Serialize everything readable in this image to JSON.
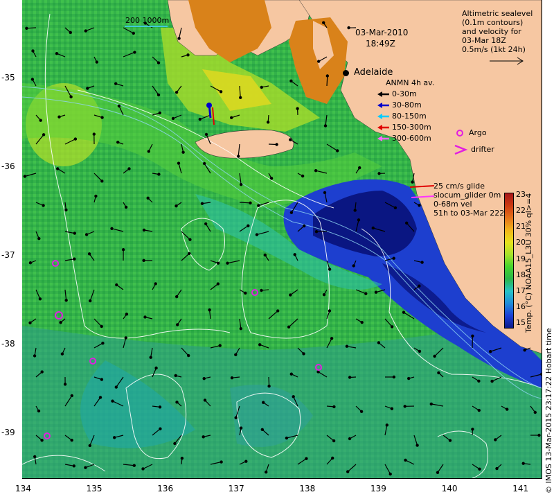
{
  "date": "03-Mar-2010",
  "time": "18:49Z",
  "scale_label": "200  1000m",
  "city": "Adelaide",
  "sealevel_legend": [
    "Altimetric sealevel",
    "(0.1m contours)",
    "and velocity for",
    "03-Mar 18Z",
    "0.5m/s (1kt 24h)"
  ],
  "anmn": {
    "title": "ANMN 4h av.",
    "items": [
      {
        "label": "0-30m",
        "color": "#000000"
      },
      {
        "label": "30-80m",
        "color": "#0000cc"
      },
      {
        "label": "80-150m",
        "color": "#00ccff"
      },
      {
        "label": "150-300m",
        "color": "#e00000"
      },
      {
        "label": "300-600m",
        "color": "#ff66ff"
      }
    ]
  },
  "argo_label": "Argo",
  "drifter_label": "drifter",
  "glider_lines": [
    "25 cm/s glide",
    "slocum_glider 0m",
    "0-68m vel",
    "51h to 03-Mar 222"
  ],
  "colorbar": {
    "ticks": [
      "23",
      "22",
      "21",
      "20",
      "19",
      "18",
      "17",
      "16",
      "15"
    ],
    "title": "Temp. (°C) NOAA15_L3U 30% ql>=4",
    "colors": [
      "#0b1a8a",
      "#1b3fd6",
      "#1f8cd8",
      "#27c2c6",
      "#2ab54a",
      "#46d42e",
      "#a7e22a",
      "#e6e21d",
      "#f1b41a",
      "#e4721a",
      "#cc3a12",
      "#a6161a"
    ]
  },
  "x_ticks": [
    "134",
    "135",
    "136",
    "137",
    "138",
    "139",
    "140",
    "141"
  ],
  "y_ticks": [
    "-35",
    "-36",
    "-37",
    "-38",
    "-39"
  ],
  "credit": "© IMOS 13-Mar-2015 23:17:22 Hobart time"
}
